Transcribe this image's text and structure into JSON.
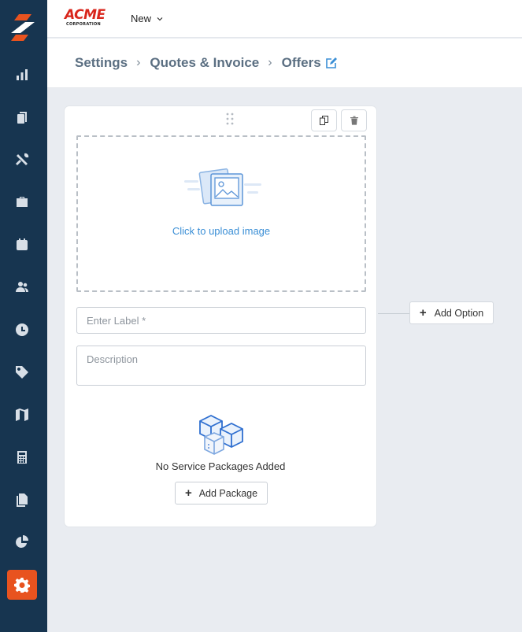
{
  "sidebar": {
    "logo_icon": "app-logo-icon",
    "items": [
      {
        "icon": "bar-chart-icon"
      },
      {
        "icon": "clipboard-icon"
      },
      {
        "icon": "tools-icon"
      },
      {
        "icon": "briefcase-icon"
      },
      {
        "icon": "calendar-icon"
      },
      {
        "icon": "users-icon"
      },
      {
        "icon": "clock-icon"
      },
      {
        "icon": "tag-icon"
      },
      {
        "icon": "map-icon"
      },
      {
        "icon": "calculator-icon"
      },
      {
        "icon": "documents-icon"
      },
      {
        "icon": "pie-chart-icon"
      },
      {
        "icon": "gear-icon",
        "active": true
      }
    ],
    "active_color": "#e8531f",
    "background": "#173550"
  },
  "topbar": {
    "brand_name": "ACME",
    "brand_sub": "CORPORATION",
    "new_label": "New"
  },
  "breadcrumb": {
    "items": [
      "Settings",
      "Quotes & Invoice",
      "Offers"
    ]
  },
  "card": {
    "upload_text": "Click to upload image",
    "label_placeholder": "Enter Label *",
    "description_placeholder": "Description",
    "empty_text": "No Service Packages Added",
    "add_package_label": "Add Package"
  },
  "add_option_label": "Add Option"
}
